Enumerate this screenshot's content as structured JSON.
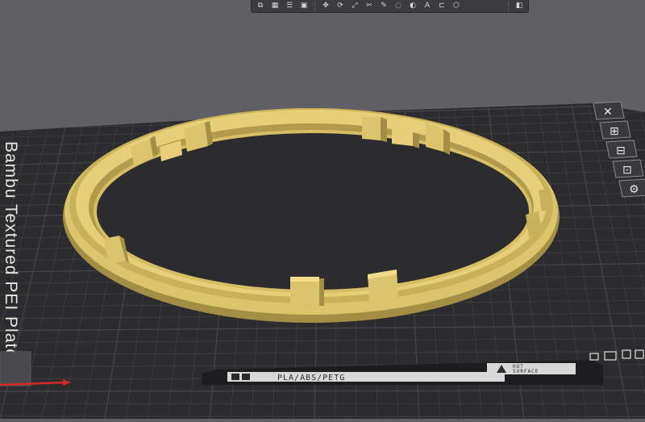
{
  "plate": {
    "name": "Bambu Textured PEI Plate",
    "filament_types": "PLA/ABS/PETG",
    "surface_line1": "HOT",
    "surface_line2": "SURFACE"
  },
  "top_toolbar": {
    "tools": [
      {
        "name": "add-object-icon",
        "glyph": "⧉"
      },
      {
        "name": "plate-grid-icon",
        "glyph": "▦"
      },
      {
        "name": "object-list-icon",
        "glyph": "☰"
      },
      {
        "name": "save-icon",
        "glyph": "▣"
      },
      {
        "name": "move-icon",
        "glyph": "✥"
      },
      {
        "name": "rotate-icon",
        "glyph": "⟳"
      },
      {
        "name": "scale-icon",
        "glyph": "⤢"
      },
      {
        "name": "cut-icon",
        "glyph": "✂"
      },
      {
        "name": "support-paint-icon",
        "glyph": "✎"
      },
      {
        "name": "seam-paint-icon",
        "glyph": "◌"
      },
      {
        "name": "color-paint-icon",
        "glyph": "◐"
      },
      {
        "name": "text-icon",
        "glyph": "A"
      },
      {
        "name": "measure-icon",
        "glyph": "⊏"
      },
      {
        "name": "assembly-icon",
        "glyph": "⬡"
      },
      {
        "name": "view-icon",
        "glyph": "◧"
      }
    ]
  },
  "plate_buttons": [
    {
      "name": "delete-plate-icon",
      "glyph": "✕"
    },
    {
      "name": "arrange-plate-icon",
      "glyph": "⊞"
    },
    {
      "name": "orient-plate-icon",
      "glyph": "⊟"
    },
    {
      "name": "lock-plate-icon",
      "glyph": "⊡"
    },
    {
      "name": "plate-settings-icon",
      "glyph": "⚙"
    }
  ],
  "status_icons": [
    {
      "name": "filament-icon",
      "glyph": "▪"
    },
    {
      "name": "bed-type-icon",
      "glyph": "▫"
    },
    {
      "name": "plate-icon",
      "glyph": "▭"
    },
    {
      "name": "warning-icon",
      "glyph": "⚠"
    }
  ],
  "colors": {
    "background": "#5f5f64",
    "plate": "#2c2c2e",
    "grid": "#464649",
    "model": "#dcc46c",
    "model_shadow": "#a28e44",
    "model_highlight": "#f0dc8c",
    "x_axis": "#d62828"
  }
}
